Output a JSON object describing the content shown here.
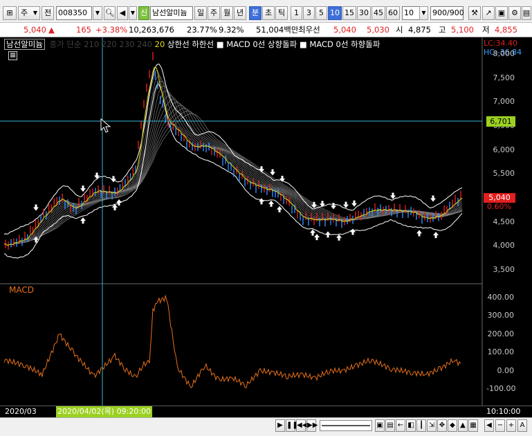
{
  "toolbar": {
    "market_label": "주",
    "type_label": "전",
    "code_value": "008350",
    "credit_badge": "신",
    "stock_name": "남선알미늄",
    "period_tabs": [
      "일",
      "주",
      "월",
      "년",
      "분",
      "초",
      "틱"
    ],
    "active_period": "분",
    "interval_buttons": [
      "1",
      "3",
      "5",
      "10",
      "15",
      "30",
      "45",
      "60"
    ],
    "active_interval": "10",
    "interval_select": "10",
    "count_value": "900",
    "count_total": "/900"
  },
  "price": {
    "current": "5,040",
    "change_arrow": "▲",
    "change": "165",
    "change_pct": "+3.38%",
    "volume": "10,263,676",
    "turnover_pct": "23.77%",
    "other_pct": "9.32%",
    "amount": "51,004백만",
    "best_label": "최우선",
    "best_ask": "5,040",
    "best_bid": "5,030",
    "open_label": "시",
    "open": "4,875",
    "high_label": "고",
    "high": "5,100",
    "low_label": "저",
    "low": "4,855"
  },
  "legend": {
    "stock": "남선알미늄",
    "ma_dim": "종가 단순 210  220  230  240",
    "ma_yellow": "20",
    "items": "상한선  하한선  ■ MACD 0선 상향돌파  ■ MACD 0선 하향돌파"
  },
  "price_axis": {
    "ticks": [
      "8,000",
      "7,500",
      "7,000",
      "6,500",
      "6,000",
      "5,500",
      "5,000",
      "4,500",
      "4,000",
      "3,500"
    ],
    "lc_label": "LC:34.40",
    "hc_label": "HC:-36.84",
    "crosshair_value": "6,701",
    "current_value": "5,040",
    "current_pct": "0.60%"
  },
  "macd": {
    "title": "MACD",
    "ticks": [
      "400.00",
      "300.00",
      "200.00",
      "100.00",
      "0.00",
      "-100.00"
    ]
  },
  "time_axis": {
    "start_label": "2020/03",
    "cursor_label": "2020/04/02(목) 09:20:00",
    "end_label": "10:10:00"
  },
  "colors": {
    "accent": "#3f6fd8",
    "up": "#e21f1f",
    "macd_line": "#e8701a",
    "crosshair": "#39b8d8",
    "cursor_tag": "#9bd020"
  },
  "chart_data": {
    "type": "line",
    "title": "",
    "series": [
      {
        "name": "남선알미늄",
        "x_index": [
          0,
          30,
          55,
          80,
          100,
          130,
          160,
          175,
          190,
          200,
          210,
          215,
          222,
          235,
          250,
          270,
          290,
          310,
          330,
          350,
          370,
          390,
          410,
          430,
          450,
          470,
          490,
          510,
          530,
          560,
          590,
          610,
          630,
          650,
          662
        ],
        "values": [
          4000,
          4150,
          4600,
          5000,
          4750,
          5150,
          5100,
          5300,
          5600,
          6800,
          7600,
          7900,
          7300,
          6600,
          6400,
          6050,
          6100,
          5900,
          5600,
          5350,
          5200,
          5150,
          4900,
          4580,
          4550,
          4550,
          4520,
          4600,
          4750,
          4750,
          4700,
          4550,
          4650,
          4900,
          5040
        ]
      }
    ],
    "macd_series": [
      {
        "name": "MACD",
        "values": [
          60,
          30,
          -20,
          200,
          100,
          -30,
          80,
          10,
          -40,
          30,
          50,
          330,
          380,
          400,
          20,
          -90,
          30,
          -50,
          -40,
          -80,
          0,
          -10,
          -30,
          -20,
          -40,
          0,
          0,
          30,
          60,
          10,
          -10,
          -20,
          10,
          60,
          30
        ]
      }
    ],
    "ylim": [
      3300,
      8200
    ],
    "macd_ylim": [
      -175,
      430
    ]
  }
}
